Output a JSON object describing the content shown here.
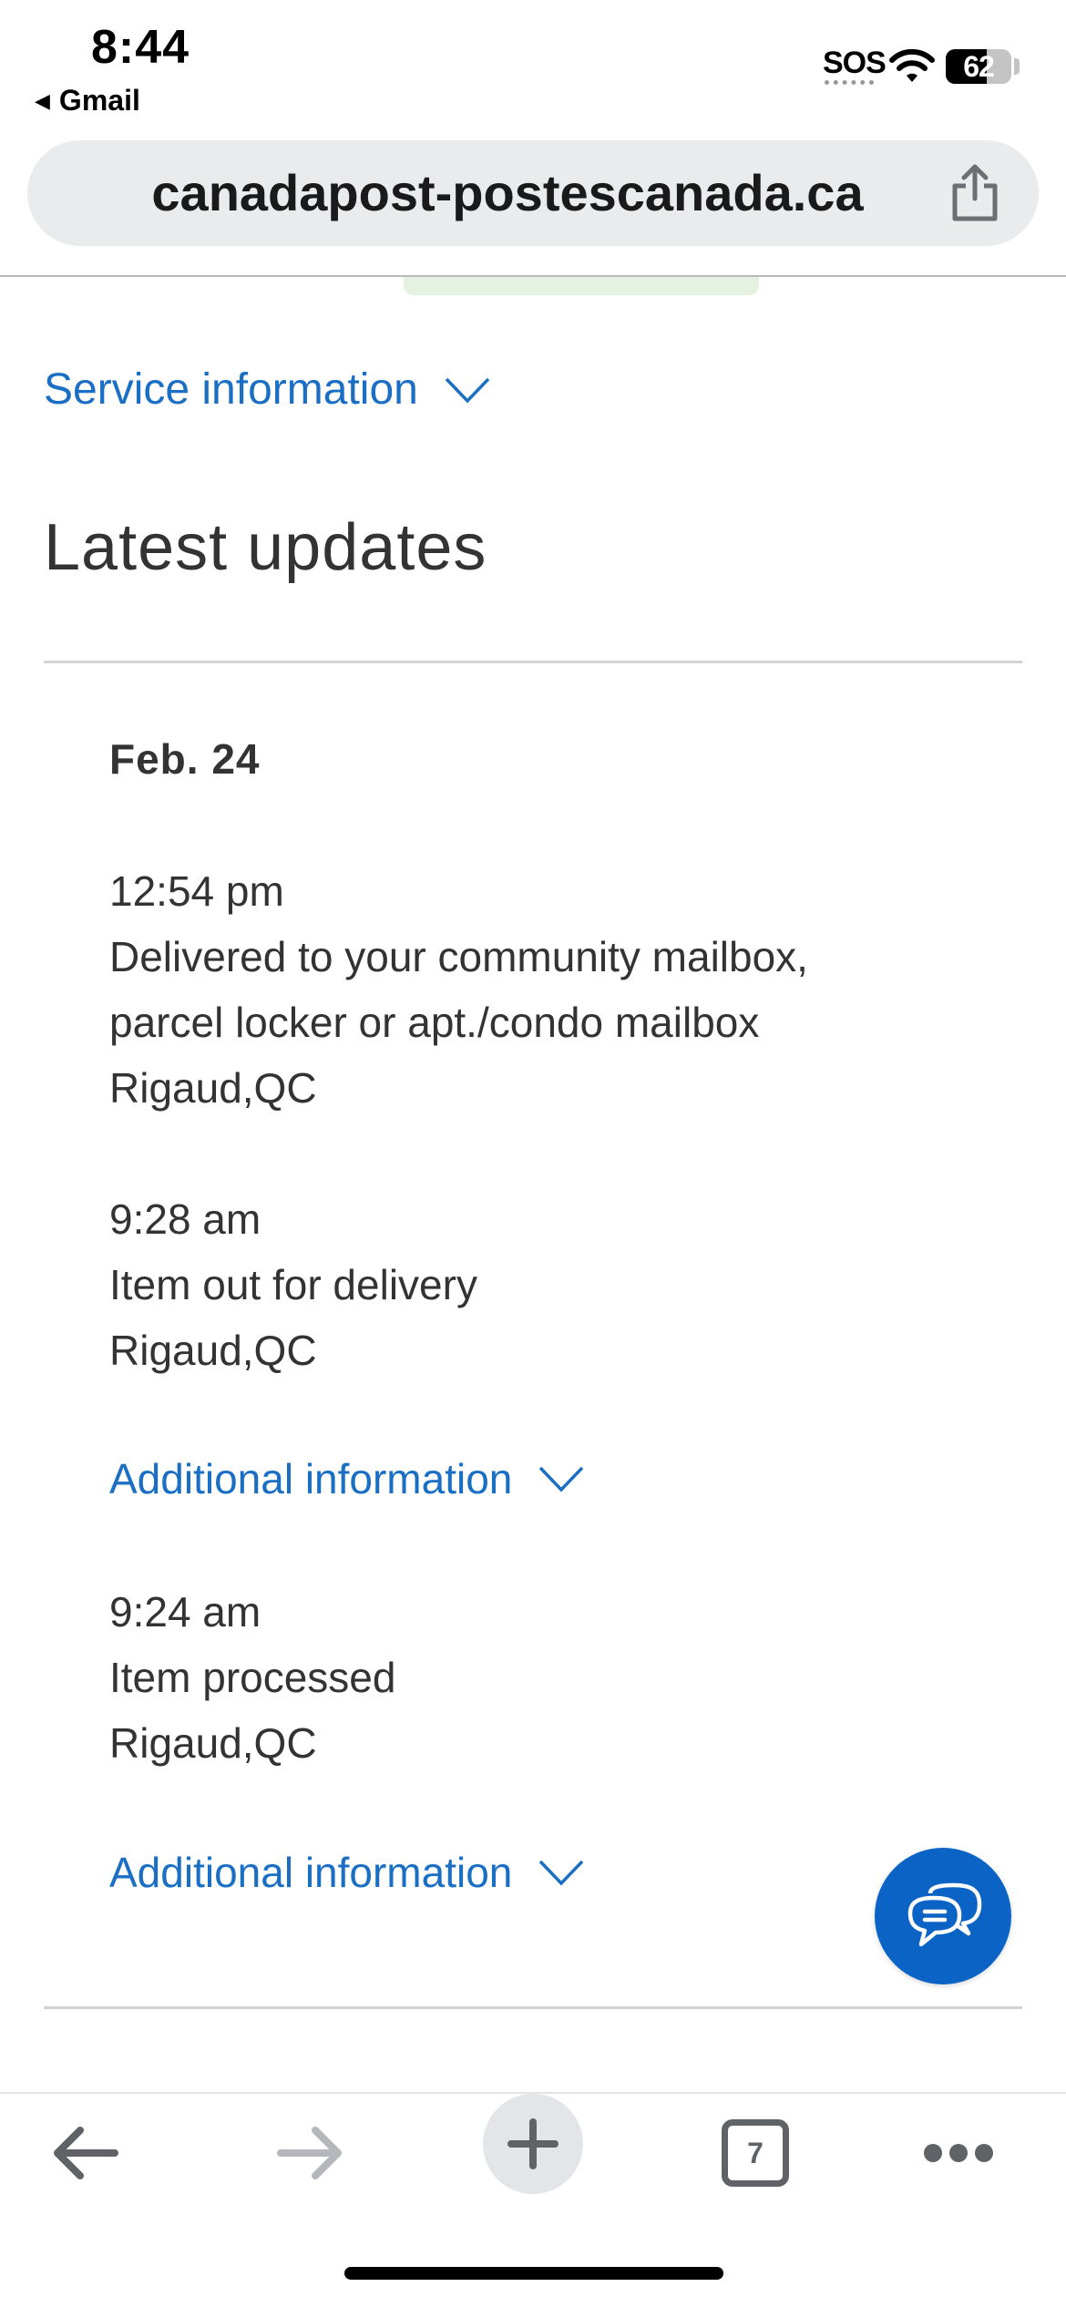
{
  "status_bar": {
    "time": "8:44",
    "back_app": "Gmail",
    "carrier": "SOS",
    "battery": "62",
    "battery_level": 0.62
  },
  "browser": {
    "url": "canadapost-postescanada.ca",
    "tab_count": "7"
  },
  "page": {
    "service_info_label": "Service information",
    "latest_updates_title": "Latest updates",
    "date": "Feb. 24",
    "events": [
      {
        "time": "12:54 pm",
        "status_line1": "Delivered to your community mailbox,",
        "status_line2": "parcel locker or apt./condo mailbox",
        "location": "Rigaud,QC"
      },
      {
        "time": "9:28 am",
        "status": "Item out for delivery",
        "location": "Rigaud,QC",
        "additional_info": "Additional information"
      },
      {
        "time": "9:24 am",
        "status": "Item processed",
        "location": "Rigaud,QC",
        "additional_info": "Additional information"
      }
    ]
  },
  "colors": {
    "link": "#1a6fc4",
    "chat_button": "#0b63c6",
    "text": "#333333"
  },
  "icons": {
    "back": "arrow-left-icon",
    "forward": "arrow-right-icon",
    "new_tab": "plus-icon",
    "more": "more-horizontal-icon",
    "share": "share-icon",
    "chat": "chat-bubble-icon"
  }
}
